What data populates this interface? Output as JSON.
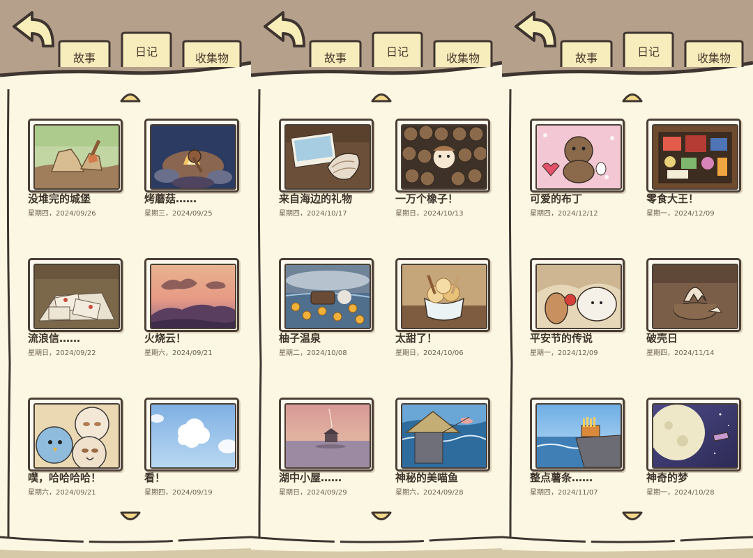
{
  "tabs": {
    "story": "故事",
    "diary": "日记",
    "collection": "收集物"
  },
  "colors": {
    "paper": "#fcf7e2",
    "outline": "#3f3530",
    "tab_bg": "#f6ecbc",
    "top_bg": "#b5a08b"
  },
  "panels": [
    {
      "entries": [
        {
          "title": "没堆完的城堡",
          "date": "星期四，2024/09/26",
          "art": "sand-castle"
        },
        {
          "title": "烤蘑菇……",
          "date": "星期三，2024/09/25",
          "art": "campfire-mushroom"
        },
        {
          "title": "流浪信……",
          "date": "星期日，2024/09/22",
          "art": "letters-pile"
        },
        {
          "title": "火烧云！",
          "date": "星期六，2024/09/21",
          "art": "sunset-clouds"
        },
        {
          "title": "噗，哈哈哈哈！",
          "date": "星期六，2024/09/21",
          "art": "laughing-birds"
        },
        {
          "title": "看！",
          "date": "星期四，2024/09/19",
          "art": "cloud-sky"
        }
      ]
    },
    {
      "entries": [
        {
          "title": "来自海边的礼物",
          "date": "星期四，2024/10/17",
          "art": "seashell-photo"
        },
        {
          "title": "一万个橡子！",
          "date": "星期日，2024/10/13",
          "art": "acorn-pile"
        },
        {
          "title": "柚子温泉",
          "date": "星期二，2024/10/08",
          "art": "yuzu-hotspring"
        },
        {
          "title": "太甜了！",
          "date": "星期日，2024/10/06",
          "art": "ice-cream"
        },
        {
          "title": "湖中小屋……",
          "date": "星期日，2024/09/29",
          "art": "lake-hut"
        },
        {
          "title": "神秘的美喵鱼",
          "date": "星期六，2024/09/28",
          "art": "mermaid-fishing"
        }
      ]
    },
    {
      "entries": [
        {
          "title": "可爱的布丁",
          "date": "星期四，2024/12/12",
          "art": "pudding-dog"
        },
        {
          "title": "零食大王！",
          "date": "星期一，2024/12/09",
          "art": "snack-box"
        },
        {
          "title": "平安节的传说",
          "date": "星期一，2024/12/09",
          "art": "apple-animals"
        },
        {
          "title": "破壳日",
          "date": "星期四，2024/11/14",
          "art": "hatched-egg"
        },
        {
          "title": "整点薯条……",
          "date": "星期四，2024/11/07",
          "art": "fries-cliff"
        },
        {
          "title": "神奇的梦",
          "date": "星期一，2024/10/28",
          "art": "moon-dream"
        }
      ]
    }
  ]
}
